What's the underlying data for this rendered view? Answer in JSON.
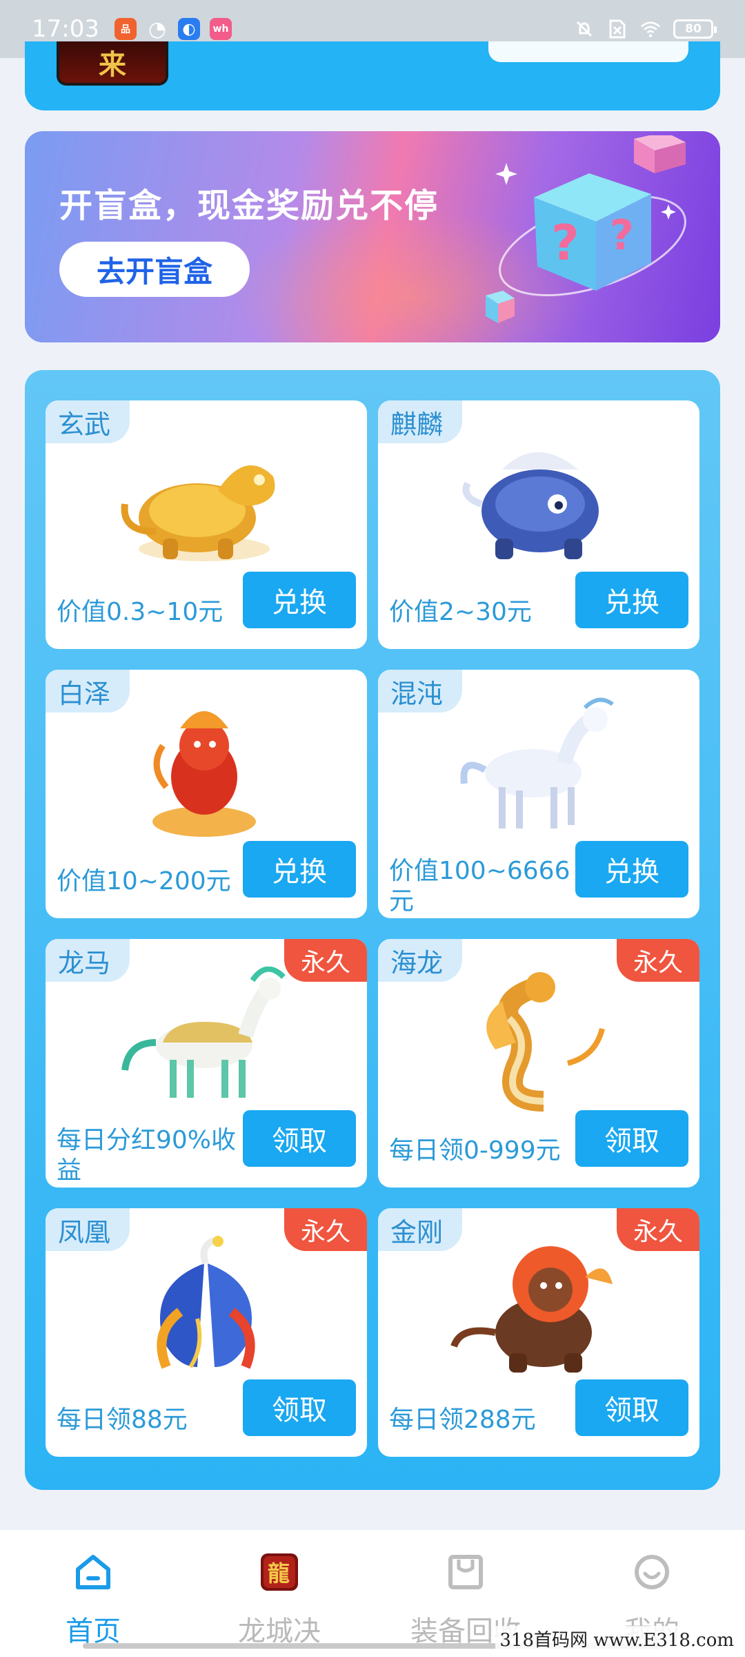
{
  "status_bar": {
    "time": "17:03",
    "battery": "80",
    "apps": [
      {
        "icon": "orange-app-icon",
        "color": "#f0632e",
        "glyph": "品"
      },
      {
        "icon": "compass-app-icon",
        "color": "#ffffff",
        "glyph": "◔"
      },
      {
        "icon": "blue-app-icon",
        "color": "#2a7df0",
        "glyph": "◐"
      },
      {
        "icon": "pink-app-icon",
        "color": "#f25b8a",
        "glyph": "wh"
      }
    ]
  },
  "top_card": {
    "thumb_text": "来"
  },
  "banner": {
    "title": "开盲盒，现金奖励兑不停",
    "button": "去开盲盒"
  },
  "pets": [
    {
      "name": "玄武",
      "value": "价值0.3~10元",
      "action": "兑换",
      "tag": "",
      "art": "golden-dragon-turtle"
    },
    {
      "name": "麒麟",
      "value": "价值2~30元",
      "action": "兑换",
      "tag": "",
      "art": "blue-qilin"
    },
    {
      "name": "白泽",
      "value": "价值10~200元",
      "action": "兑换",
      "tag": "",
      "art": "red-baize"
    },
    {
      "name": "混沌",
      "value": "价值100~6666元",
      "action": "兑换",
      "tag": "",
      "art": "white-hundun"
    },
    {
      "name": "龙马",
      "value": "每日分红90%收益",
      "action": "领取",
      "tag": "永久",
      "art": "dragon-horse"
    },
    {
      "name": "海龙",
      "value": "每日领0-999元",
      "action": "领取",
      "tag": "永久",
      "art": "sea-dragon"
    },
    {
      "name": "凤凰",
      "value": "每日领88元",
      "action": "领取",
      "tag": "永久",
      "art": "phoenix"
    },
    {
      "name": "金刚",
      "value": "每日领288元",
      "action": "领取",
      "tag": "永久",
      "art": "king-kong"
    }
  ],
  "bottom_nav": [
    {
      "label": "首页",
      "icon": "home-icon",
      "active": true
    },
    {
      "label": "龙城决",
      "icon": "game-app-icon",
      "active": false
    },
    {
      "label": "装备回收",
      "icon": "recycle-bag-icon",
      "active": false
    },
    {
      "label": "我的",
      "icon": "profile-icon",
      "active": false
    }
  ],
  "watermark": "318首码网  www.E318.com",
  "colors": {
    "accent": "#19a8f1",
    "tag_red": "#f0553f",
    "panel_blue": "#2bb3f5"
  }
}
